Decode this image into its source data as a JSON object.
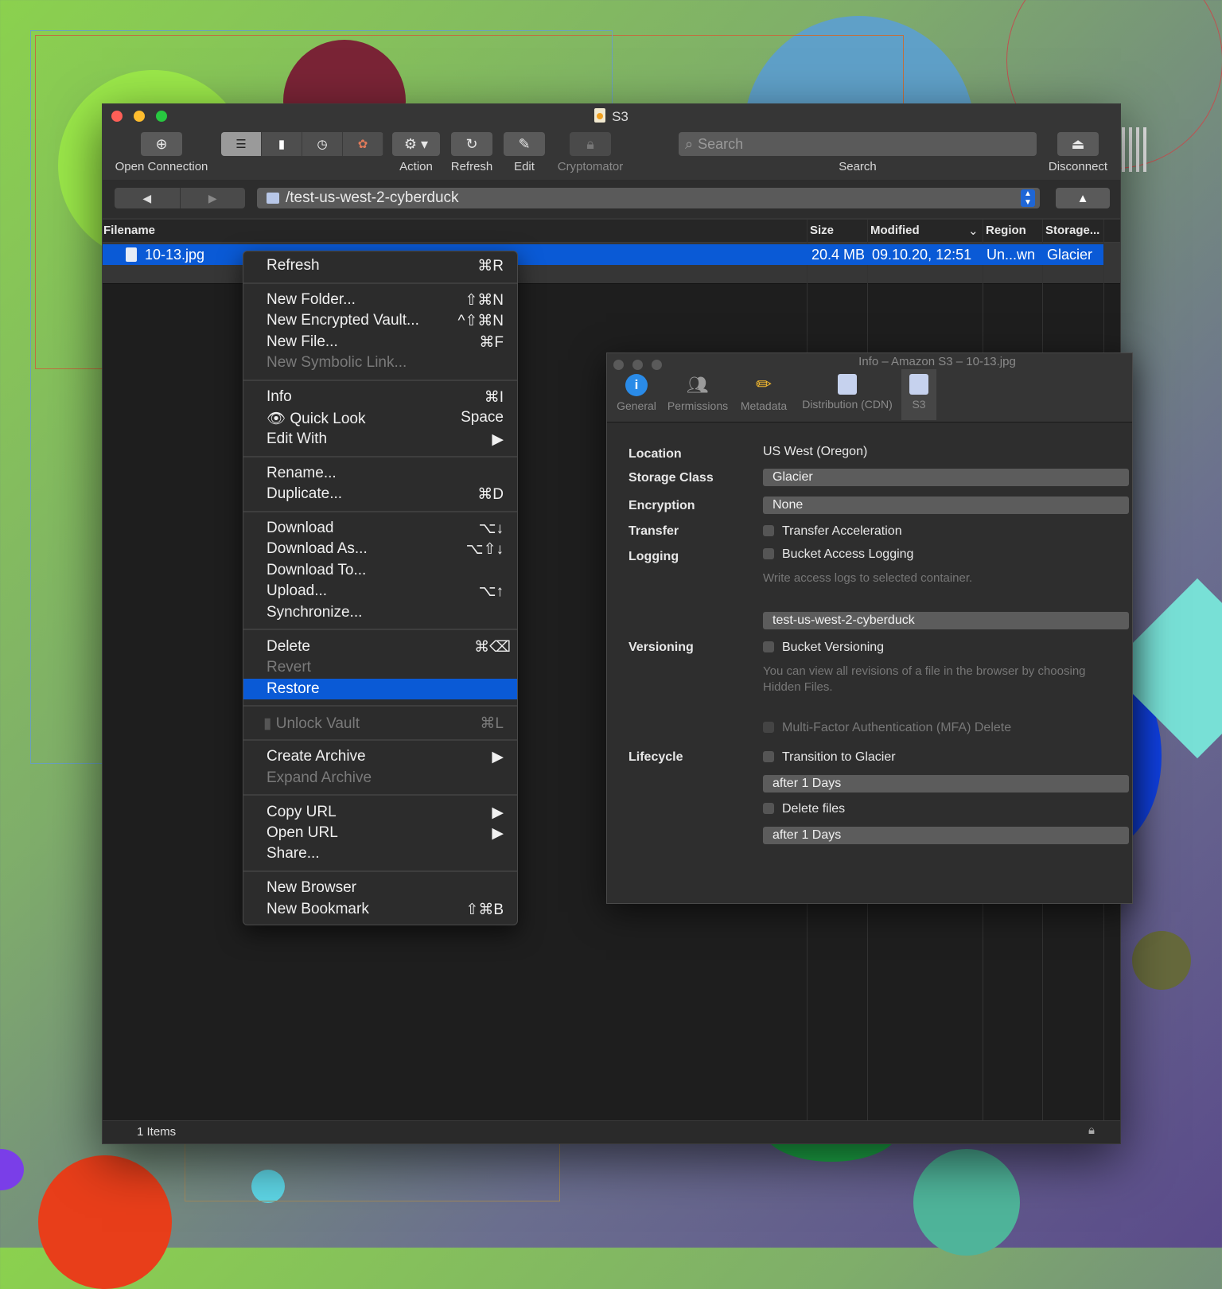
{
  "window": {
    "title": "S3",
    "toolbar": {
      "open_connection": "Open Connection",
      "action": "Action",
      "refresh": "Refresh",
      "edit": "Edit",
      "cryptomator": "Cryptomator",
      "search_placeholder": "Search",
      "search_label": "Search",
      "disconnect": "Disconnect"
    },
    "path": "/test-us-west-2-cyberduck",
    "columns": {
      "filename": "Filename",
      "size": "Size",
      "modified": "Modified",
      "region": "Region",
      "storage": "Storage..."
    },
    "rows": [
      {
        "filename": "10-13.jpg",
        "size": "20.4 MB",
        "modified": "09.10.20, 12:51",
        "region": "Un...wn",
        "storage": "Glacier"
      }
    ],
    "status": "1 Items"
  },
  "context_menu": {
    "items": [
      {
        "label": "Refresh",
        "shortcut": "⌘R"
      },
      {
        "label": "New Folder...",
        "shortcut": "⇧⌘N"
      },
      {
        "label": "New Encrypted Vault...",
        "shortcut": "^⇧⌘N"
      },
      {
        "label": "New File...",
        "shortcut": "⌘F"
      },
      {
        "label": "New Symbolic Link...",
        "shortcut": ""
      },
      {
        "label": "Info",
        "shortcut": "⌘I"
      },
      {
        "label": "Quick Look",
        "shortcut": "Space"
      },
      {
        "label": "Edit With",
        "shortcut": "▶"
      },
      {
        "label": "Rename...",
        "shortcut": ""
      },
      {
        "label": "Duplicate...",
        "shortcut": "⌘D"
      },
      {
        "label": "Download",
        "shortcut": "⌥↓"
      },
      {
        "label": "Download As...",
        "shortcut": "⌥⇧↓"
      },
      {
        "label": "Download To...",
        "shortcut": ""
      },
      {
        "label": "Upload...",
        "shortcut": "⌥↑"
      },
      {
        "label": "Synchronize...",
        "shortcut": ""
      },
      {
        "label": "Delete",
        "shortcut": "⌘⌫"
      },
      {
        "label": "Revert",
        "shortcut": ""
      },
      {
        "label": "Restore",
        "shortcut": ""
      },
      {
        "label": "Unlock Vault",
        "shortcut": "⌘L"
      },
      {
        "label": "Create Archive",
        "shortcut": "▶"
      },
      {
        "label": "Expand Archive",
        "shortcut": ""
      },
      {
        "label": "Copy URL",
        "shortcut": "▶"
      },
      {
        "label": "Open URL",
        "shortcut": "▶"
      },
      {
        "label": "Share...",
        "shortcut": ""
      },
      {
        "label": "New Browser",
        "shortcut": ""
      },
      {
        "label": "New Bookmark",
        "shortcut": "⇧⌘B"
      }
    ]
  },
  "info_window": {
    "title": "Info – Amazon S3 – 10-13.jpg",
    "tabs": [
      "General",
      "Permissions",
      "Metadata",
      "Distribution (CDN)",
      "S3"
    ],
    "active_tab": "S3",
    "location_label": "Location",
    "location_value": "US West (Oregon)",
    "storage_class_label": "Storage Class",
    "storage_class_value": "Glacier",
    "encryption_label": "Encryption",
    "encryption_value": "None",
    "transfer_label": "Transfer",
    "transfer_acceleration": "Transfer Acceleration",
    "logging_label": "Logging",
    "bucket_access_logging": "Bucket Access Logging",
    "logging_note": "Write access logs to selected container.",
    "logging_target": "test-us-west-2-cyberduck",
    "versioning_label": "Versioning",
    "bucket_versioning": "Bucket Versioning",
    "versioning_note": "You can view all revisions of a file in the browser by choosing Hidden Files.",
    "mfa_delete": "Multi-Factor Authentication (MFA) Delete",
    "lifecycle_label": "Lifecycle",
    "transition_to_glacier": "Transition to Glacier",
    "transition_after": "after 1 Days",
    "delete_files": "Delete files",
    "delete_after": "after 1 Days"
  },
  "colors": {
    "selection": "#0a5ad6",
    "window_bg": "#1e1e1e",
    "toolbar_bg": "#363636"
  }
}
